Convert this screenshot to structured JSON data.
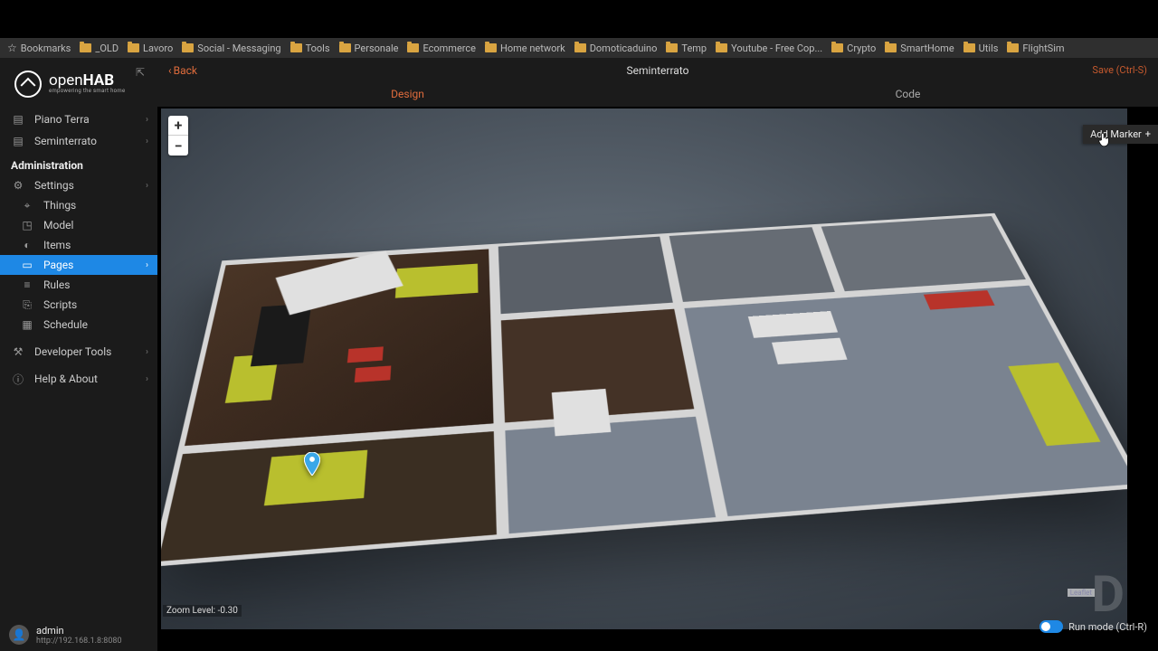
{
  "bookmarks": [
    {
      "label": "Bookmarks",
      "type": "star"
    },
    {
      "label": "_OLD",
      "type": "folder"
    },
    {
      "label": "Lavoro",
      "type": "folder"
    },
    {
      "label": "Social - Messaging",
      "type": "folder"
    },
    {
      "label": "Tools",
      "type": "folder"
    },
    {
      "label": "Personale",
      "type": "folder"
    },
    {
      "label": "Ecommerce",
      "type": "folder"
    },
    {
      "label": "Home network",
      "type": "folder"
    },
    {
      "label": "Domoticaduino",
      "type": "folder"
    },
    {
      "label": "Temp",
      "type": "folder"
    },
    {
      "label": "Youtube - Free Cop...",
      "type": "folder"
    },
    {
      "label": "Crypto",
      "type": "folder"
    },
    {
      "label": "SmartHome",
      "type": "folder"
    },
    {
      "label": "Utils",
      "type": "folder"
    },
    {
      "label": "FlightSim",
      "type": "folder"
    }
  ],
  "logo": {
    "brand_a": "open",
    "brand_b": "HAB",
    "tagline": "empowering the smart home"
  },
  "sidebar": {
    "floors": [
      {
        "label": "Piano Terra"
      },
      {
        "label": "Seminterrato"
      }
    ],
    "admin_title": "Administration",
    "settings_label": "Settings",
    "settings_items": [
      {
        "label": "Things"
      },
      {
        "label": "Model"
      },
      {
        "label": "Items"
      },
      {
        "label": "Pages",
        "active": true
      },
      {
        "label": "Rules"
      },
      {
        "label": "Scripts"
      },
      {
        "label": "Schedule"
      }
    ],
    "dev_label": "Developer Tools",
    "help_label": "Help & About"
  },
  "user": {
    "name": "admin",
    "url": "http://192.168.1.8:8080"
  },
  "header": {
    "back_label": "Back",
    "title": "Seminterrato",
    "save_label": "Save (Ctrl-S)"
  },
  "tabs": {
    "design": "Design",
    "code": "Code"
  },
  "canvas": {
    "zoom_in": "+",
    "zoom_out": "−",
    "add_marker": "Add Marker",
    "zoom_label": "Zoom Level: -0.30",
    "run_mode": "Run mode (Ctrl-R)",
    "leaflet": "Leaflet"
  }
}
